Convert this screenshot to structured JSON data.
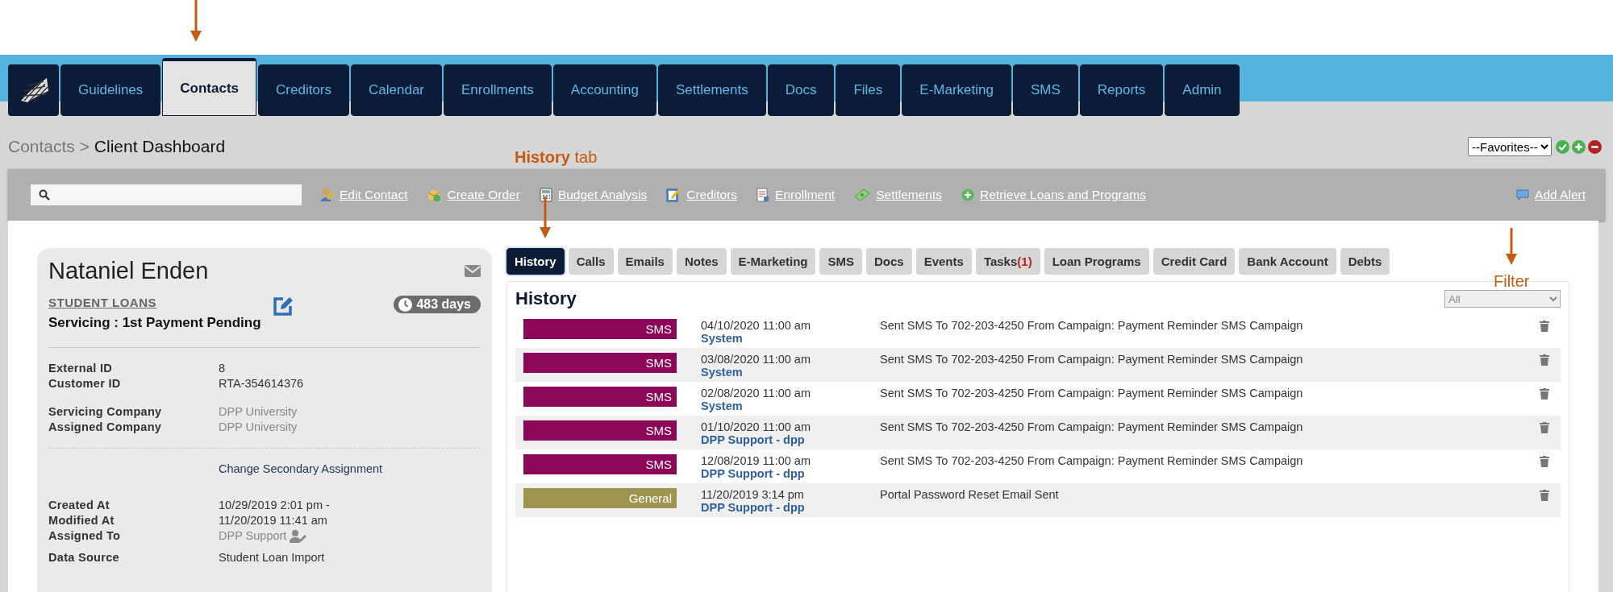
{
  "nav_tabs": [
    {
      "label": "Guidelines",
      "selected": false
    },
    {
      "label": "Contacts",
      "selected": true
    },
    {
      "label": "Creditors",
      "selected": false
    },
    {
      "label": "Calendar",
      "selected": false
    },
    {
      "label": "Enrollments",
      "selected": false
    },
    {
      "label": "Accounting",
      "selected": false
    },
    {
      "label": "Settlements",
      "selected": false
    },
    {
      "label": "Docs",
      "selected": false
    },
    {
      "label": "Files",
      "selected": false
    },
    {
      "label": "E-Marketing",
      "selected": false
    },
    {
      "label": "SMS",
      "selected": false
    },
    {
      "label": "Reports",
      "selected": false
    },
    {
      "label": "Admin",
      "selected": false
    }
  ],
  "breadcrumb": {
    "parent": "Contacts",
    "separator": ">",
    "current": "Client Dashboard"
  },
  "favorites": {
    "value": "--Favorites--"
  },
  "toolbar": {
    "links": [
      {
        "label": "Edit Contact",
        "kind": "person"
      },
      {
        "label": "Create Order",
        "kind": "box"
      },
      {
        "label": "Budget Analysis",
        "kind": "calc"
      },
      {
        "label": "Creditors",
        "kind": "edit"
      },
      {
        "label": "Enrollment",
        "kind": "doc"
      },
      {
        "label": "Settlements",
        "kind": "money"
      },
      {
        "label": "Retrieve Loans and Programs",
        "kind": "plus"
      }
    ],
    "alert": "Add Alert"
  },
  "contact": {
    "name": "Nataniel Enden",
    "program": "STUDENT LOANS",
    "status_label": "Servicing :",
    "status": "1st Payment Pending",
    "days": "483 days",
    "groups": [
      [
        {
          "label": "External ID",
          "value": "8",
          "muted": false
        },
        {
          "label": "Customer ID",
          "value": "RTA-354614376",
          "muted": false
        }
      ],
      [
        {
          "label": "Servicing Company",
          "value": "DPP University",
          "muted": true
        },
        {
          "label": "Assigned Company",
          "value": "DPP University",
          "muted": true
        }
      ]
    ],
    "secondary_link": "Change Secondary Assignment",
    "dates": [
      {
        "label": "Created At",
        "value": "10/29/2019 2:01 pm -",
        "muted": false
      },
      {
        "label": "Modified At",
        "value": "11/20/2019 11:41 am",
        "muted": false
      },
      {
        "label": "Assigned To",
        "value": "DPP Support",
        "muted": true
      }
    ],
    "data_source": {
      "label": "Data Source",
      "value": "Student Loan Import"
    }
  },
  "sub_tabs": [
    {
      "label": "History",
      "selected": true
    },
    {
      "label": "Calls",
      "selected": false
    },
    {
      "label": "Emails",
      "selected": false
    },
    {
      "label": "Notes",
      "selected": false
    },
    {
      "label": "E-Marketing",
      "selected": false
    },
    {
      "label": "SMS",
      "selected": false
    },
    {
      "label": "Docs",
      "selected": false
    },
    {
      "label": "Events",
      "selected": false
    },
    {
      "label": "Tasks",
      "count": "(1)",
      "selected": false
    },
    {
      "label": "Loan Programs",
      "selected": false
    },
    {
      "label": "Credit Card",
      "selected": false
    },
    {
      "label": "Bank Account",
      "selected": false
    },
    {
      "label": "Debts",
      "selected": false
    }
  ],
  "history": {
    "title": "History",
    "filter": "All",
    "rows": [
      {
        "type": "SMS",
        "color": "#8c0757",
        "date": "04/10/2020 11:00 am",
        "user": "System",
        "text": "Sent SMS To 702-203-4250 From Campaign: Payment Reminder SMS Campaign"
      },
      {
        "type": "SMS",
        "color": "#8c0757",
        "date": "03/08/2020 11:00 am",
        "user": "System",
        "text": "Sent SMS To 702-203-4250 From Campaign: Payment Reminder SMS Campaign"
      },
      {
        "type": "SMS",
        "color": "#8c0757",
        "date": "02/08/2020 11:00 am",
        "user": "System",
        "text": "Sent SMS To 702-203-4250 From Campaign: Payment Reminder SMS Campaign"
      },
      {
        "type": "SMS",
        "color": "#8c0757",
        "date": "01/10/2020 11:00 am",
        "user": "DPP Support - dpp",
        "text": "Sent SMS To 702-203-4250 From Campaign: Payment Reminder SMS Campaign"
      },
      {
        "type": "SMS",
        "color": "#8c0757",
        "date": "12/08/2019 11:00 am",
        "user": "DPP Support - dpp",
        "text": "Sent SMS To 702-203-4250 From Campaign: Payment Reminder SMS Campaign"
      },
      {
        "type": "General",
        "color": "#a0954f",
        "date": "11/20/2019 3:14 pm",
        "user": "DPP Support - dpp",
        "text": "Portal Password Reset Email Sent"
      }
    ]
  },
  "annotations": [
    {
      "kind": "tab",
      "bold": "History",
      "rest": " tab"
    },
    {
      "kind": "filter",
      "rest": "Filter"
    }
  ]
}
